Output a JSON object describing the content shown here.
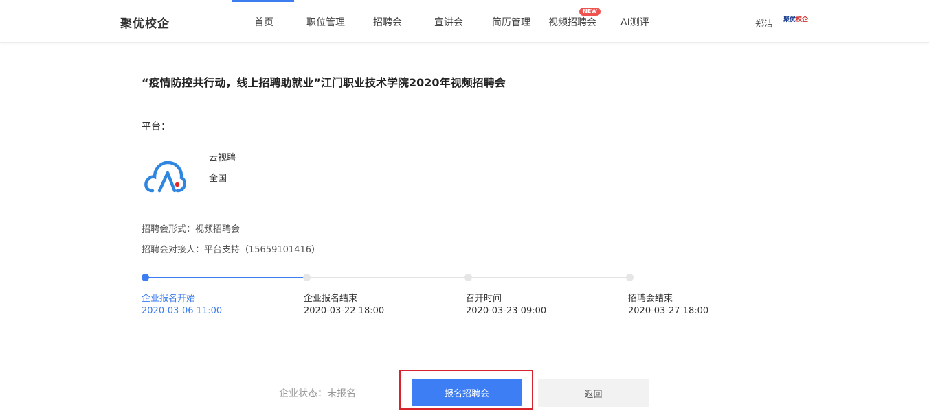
{
  "header": {
    "brand": "聚优校企",
    "nav": [
      {
        "label": "首页"
      },
      {
        "label": "职位管理"
      },
      {
        "label": "招聘会"
      },
      {
        "label": "宣讲会"
      },
      {
        "label": "简历管理"
      },
      {
        "label": "视频招聘会",
        "badge": "NEW"
      },
      {
        "label": "AI测评"
      }
    ],
    "user_name": "郑洁",
    "user_logo_text_a": "聚优",
    "user_logo_text_b": "校企"
  },
  "event": {
    "title": "“疫情防控共行动，线上招聘助就业”江门职业技术学院2020年视频招聘会",
    "platform_label": "平台：",
    "platform_name": "云视聘",
    "platform_region": "全国",
    "format_line": "招聘会形式：视频招聘会",
    "contact_line": "招聘会对接人：平台支持（15659101416）"
  },
  "timeline": [
    {
      "label": "企业报名开始",
      "date": "2020-03-06 11:00",
      "active": true
    },
    {
      "label": "企业报名结束",
      "date": "2020-03-22 18:00",
      "active": false
    },
    {
      "label": "召开时间",
      "date": "2020-03-23 09:00",
      "active": false
    },
    {
      "label": "招聘会结束",
      "date": "2020-03-27 18:00",
      "active": false
    }
  ],
  "actions": {
    "status_text": "企业状态：未报名",
    "register_label": "报名招聘会",
    "back_label": "返回"
  },
  "colors": {
    "accent": "#3d7ef5",
    "highlight": "#d9232a",
    "badge": "#ef5350"
  }
}
